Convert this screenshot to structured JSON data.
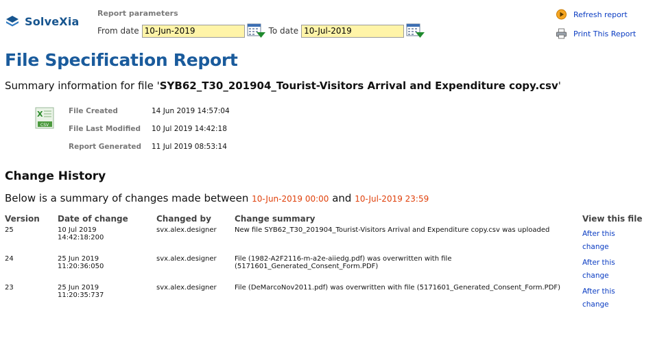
{
  "brand": {
    "name": "SolveXia",
    "color": "#17558f"
  },
  "params": {
    "title": "Report parameters",
    "from_label": "From date",
    "from_value": "10-Jun-2019",
    "to_label": "To date",
    "to_value": "10-Jul-2019"
  },
  "actions": {
    "refresh_label": "Refresh report",
    "print_label": "Print This Report"
  },
  "page_title": "File Specification Report",
  "summary": {
    "prefix": "Summary information for file '",
    "filename": "SYB62_T30_201904_Tourist-Visitors Arrival and Expenditure copy.csv",
    "suffix": "'"
  },
  "file_meta": {
    "icon": "csv-file-icon",
    "rows": [
      {
        "key": "File Created",
        "value": "14 Jun 2019 14:57:04"
      },
      {
        "key": "File Last Modified",
        "value": "10 Jul 2019 14:42:18"
      },
      {
        "key": "Report Generated",
        "value": "11 Jul 2019 08:53:14"
      }
    ]
  },
  "history": {
    "title": "Change History",
    "between_prefix": "Below is a summary of changes made between",
    "between_from": "10-Jun-2019 00:00",
    "between_and": "and",
    "between_to": "10-Jul-2019 23:59",
    "columns": [
      "Version",
      "Date of change",
      "Changed by",
      "Change summary",
      "View this file"
    ],
    "rows": [
      {
        "version": "25",
        "date": "10 Jul 2019",
        "time": "14:42:18:200",
        "by": "svx.alex.designer",
        "summary": "New file SYB62_T30_201904_Tourist-Visitors Arrival and Expenditure copy.csv was uploaded",
        "view_1": "After this",
        "view_2": "change"
      },
      {
        "version": "24",
        "date": "25 Jun 2019",
        "time": "11:20:36:050",
        "by": "svx.alex.designer",
        "summary": "File (1982-A2F2116-m-a2e-aiiedg.pdf) was overwritten with file (5171601_Generated_Consent_Form.PDF)",
        "view_1": "After this",
        "view_2": "change"
      },
      {
        "version": "23",
        "date": "25 Jun 2019",
        "time": "11:20:35:737",
        "by": "svx.alex.designer",
        "summary": "File (DeMarcoNov2011.pdf) was overwritten with file (5171601_Generated_Consent_Form.PDF)",
        "view_1": "After this",
        "view_2": "change"
      }
    ]
  },
  "colors": {
    "link": "#0a3cc2",
    "title": "#1a5b9c",
    "date_highlight": "#e0400b",
    "input_bg": "#fff4a8"
  }
}
